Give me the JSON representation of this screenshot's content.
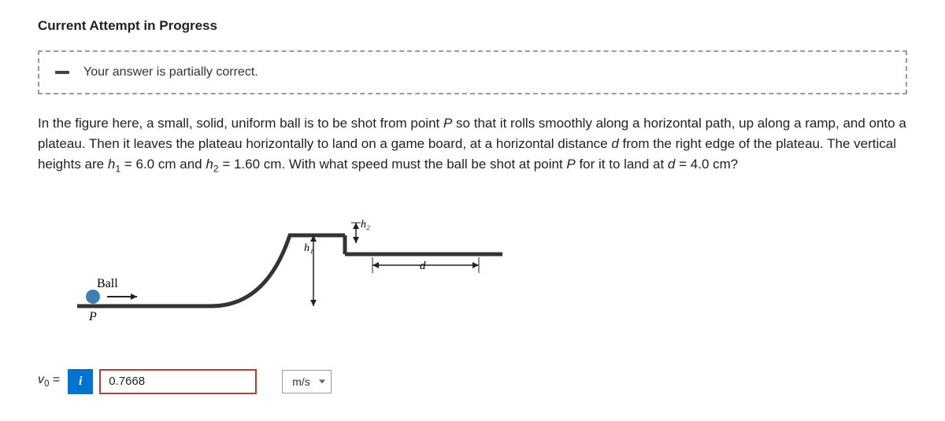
{
  "heading": "Current Attempt in Progress",
  "alert": {
    "message": "Your answer is partially correct."
  },
  "problem": {
    "pre": "In the figure here, a small, solid, uniform ball is to be shot from point ",
    "pointP": "P",
    "mid1": " so that it rolls smoothly along a horizontal path, up along a ramp, and onto a plateau. Then it leaves the plateau horizontally to land on a game board, at a horizontal distance ",
    "d": "d",
    "mid2": " from the right edge of the plateau. The vertical heights are ",
    "h1": "h",
    "h1sub": "1",
    "h1val": " = 6.0 cm and ",
    "h2": "h",
    "h2sub": "2",
    "h2val": " = 1.60 cm. With what speed must the ball be shot at point ",
    "pointP2": "P",
    "mid3": " for it to land at ",
    "d2": "d",
    "end": " = 4.0 cm?"
  },
  "figure": {
    "ball_label": "Ball",
    "p_label": "P",
    "h1_label": "h₁",
    "h2_label": "h₂",
    "d_label": "d"
  },
  "answer": {
    "label_v": "v",
    "label_sub": "0",
    "label_eq": " = ",
    "info_glyph": "i",
    "value": "0.7668",
    "unit": "m/s"
  }
}
